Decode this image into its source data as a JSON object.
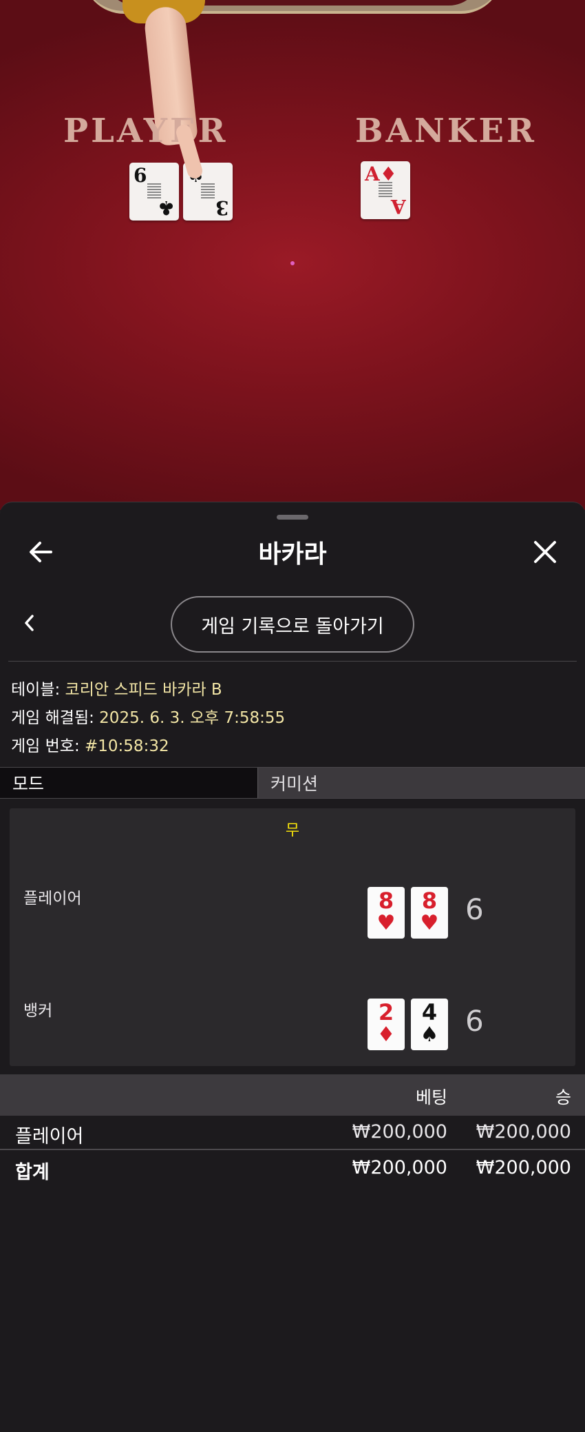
{
  "video": {
    "zones": {
      "player": "PLAYER",
      "banker": "BANKER"
    },
    "table_cards": {
      "player": [
        {
          "rank": "6",
          "suit": "♣",
          "color": "black"
        },
        {
          "rank": "3",
          "suit": "♠",
          "color": "black"
        }
      ],
      "banker": [
        {
          "rank": "A",
          "suit": "♦",
          "color": "red"
        }
      ]
    }
  },
  "sheet": {
    "title": "바카라",
    "back_to_history": "게임 기록으로 돌아가기",
    "info": {
      "table_label": "테이블: ",
      "table_value": "코리안 스피드 바카라 B",
      "resolved_label": "게임 해결됨: ",
      "resolved_value": "2025. 6. 3. 오후 7:58:55",
      "number_label": "게임 번호: ",
      "number_value": "#10:58:32"
    },
    "tabs": {
      "mode": "모드",
      "commission": "커미션"
    },
    "result": {
      "outcome": "무",
      "player_label": "플레이어",
      "banker_label": "뱅커",
      "player_cards": [
        {
          "rank": "8",
          "suit": "♥",
          "color": "red"
        },
        {
          "rank": "8",
          "suit": "♥",
          "color": "red"
        }
      ],
      "banker_cards": [
        {
          "rank": "2",
          "suit": "♦",
          "color": "red"
        },
        {
          "rank": "4",
          "suit": "♠",
          "color": "black"
        }
      ],
      "player_score": "6",
      "banker_score": "6"
    },
    "bets": {
      "col_bet": "베팅",
      "col_win": "승",
      "rows": [
        {
          "name": "플레이어",
          "bet": "₩200,000",
          "win": "₩200,000"
        }
      ],
      "total": {
        "name": "합계",
        "bet": "₩200,000",
        "win": "₩200,000"
      }
    }
  },
  "colors": {
    "accent_value": "#f3e6a6",
    "outcome": "#f5e10a",
    "felt": "#7e131d"
  }
}
